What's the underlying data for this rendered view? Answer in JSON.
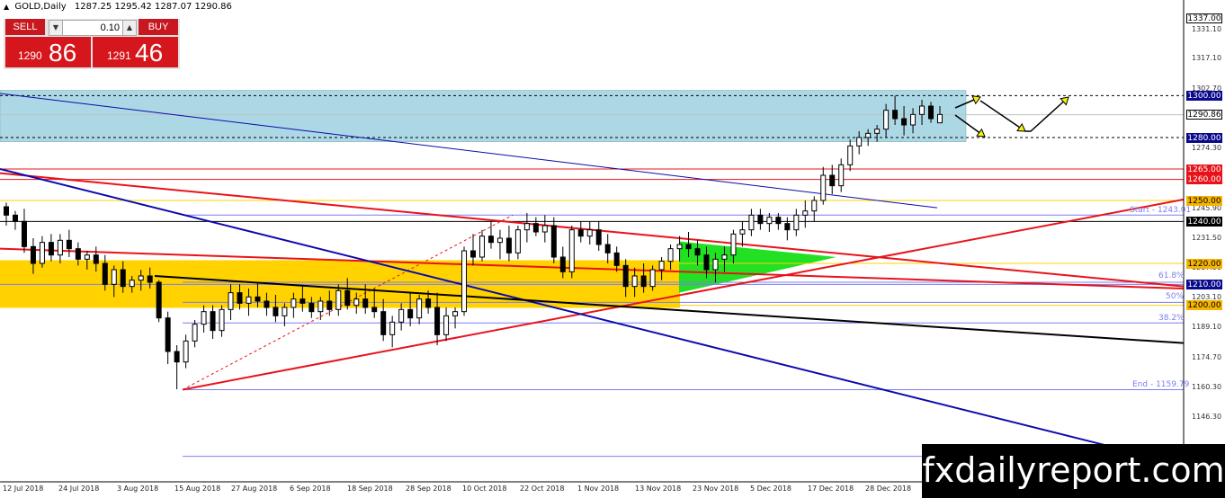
{
  "header": {
    "symbol_label": "GOLD,Daily",
    "ohlc": "1287.25 1295.42 1287.07 1290.86"
  },
  "trade_panel": {
    "sell_label": "SELL",
    "buy_label": "BUY",
    "lot_value": "0.10",
    "sell_small": "1290",
    "sell_big": "86",
    "buy_small": "1291",
    "buy_big": "46"
  },
  "price_axis": {
    "labels": [
      "1331.10",
      "1317.10",
      "1302.70",
      "1274.30",
      "1245.90",
      "1231.50",
      "1217.50",
      "1203.10",
      "1189.10",
      "1174.70",
      "1160.30",
      "1146.30",
      "1131.90"
    ],
    "tags": [
      {
        "text": "1337.00",
        "bg": "#ffffff",
        "fg": "#000000",
        "border": "#000000"
      },
      {
        "text": "1300.00",
        "bg": "#0a0a8c",
        "fg": "#ffffff",
        "border": "#0a0a8c"
      },
      {
        "text": "1290.86",
        "bg": "#ffffff",
        "fg": "#000000",
        "border": "#000000"
      },
      {
        "text": "1280.00",
        "bg": "#0a0a8c",
        "fg": "#ffffff",
        "border": "#0a0a8c"
      },
      {
        "text": "1265.00",
        "bg": "#e8131a",
        "fg": "#ffffff",
        "border": "#e8131a"
      },
      {
        "text": "1260.00",
        "bg": "#e8131a",
        "fg": "#ffffff",
        "border": "#e8131a"
      },
      {
        "text": "1250.00",
        "bg": "#f5b400",
        "fg": "#000000",
        "border": "#f5b400"
      },
      {
        "text": "1240.00",
        "bg": "#000000",
        "fg": "#ffffff",
        "border": "#000000"
      },
      {
        "text": "1220.00",
        "bg": "#f5b400",
        "fg": "#000000",
        "border": "#f5b400"
      },
      {
        "text": "1210.00",
        "bg": "#0a0a8c",
        "fg": "#ffffff",
        "border": "#0a0a8c"
      },
      {
        "text": "1200.00",
        "bg": "#f5b400",
        "fg": "#000000",
        "border": "#f5b400"
      }
    ]
  },
  "time_axis": [
    "12 Jul 2018",
    "24 Jul 2018",
    "3 Aug 2018",
    "15 Aug 2018",
    "27 Aug 2018",
    "6 Sep 2018",
    "18 Sep 2018",
    "28 Sep 2018",
    "10 Oct 2018",
    "22 Oct 2018",
    "1 Nov 2018",
    "13 Nov 2018",
    "23 Nov 2018",
    "5 Dec 2018",
    "17 Dec 2018",
    "28 Dec 2018"
  ],
  "fibonacci": {
    "start": "Start - 1243.01",
    "level_618": "61.8%",
    "level_50": "50%",
    "level_382": "38.2%",
    "end": "End - 1159.79"
  },
  "watermark": "fxdailyreport.com",
  "colors": {
    "resistance_zone": "#acd8e6",
    "support_zone": "#ffd200",
    "triangle": "#22e022",
    "trendline_red": "#e8131a",
    "trendline_blue": "#0a0aaa",
    "fib_line": "#7d7df0",
    "arrow": "#f5f500"
  },
  "candles": [
    [
      1247,
      1249,
      1238,
      1243
    ],
    [
      1243,
      1245,
      1236,
      1240
    ],
    [
      1240,
      1246,
      1225,
      1228
    ],
    [
      1228,
      1232,
      1215,
      1220
    ],
    [
      1220,
      1233,
      1218,
      1230
    ],
    [
      1230,
      1234,
      1221,
      1224
    ],
    [
      1224,
      1234,
      1220,
      1231
    ],
    [
      1231,
      1236,
      1223,
      1227
    ],
    [
      1227,
      1230,
      1219,
      1222
    ],
    [
      1222,
      1226,
      1217,
      1224
    ],
    [
      1224,
      1228,
      1216,
      1220
    ],
    [
      1220,
      1224,
      1207,
      1210
    ],
    [
      1210,
      1219,
      1204,
      1217
    ],
    [
      1217,
      1221,
      1206,
      1209
    ],
    [
      1209,
      1214,
      1206,
      1212
    ],
    [
      1212,
      1217,
      1207,
      1214
    ],
    [
      1214,
      1218,
      1208,
      1211
    ],
    [
      1211,
      1212,
      1192,
      1194
    ],
    [
      1194,
      1197,
      1172,
      1178
    ],
    [
      1178,
      1181,
      1160,
      1173
    ],
    [
      1173,
      1186,
      1170,
      1183
    ],
    [
      1183,
      1193,
      1180,
      1191
    ],
    [
      1191,
      1200,
      1187,
      1197
    ],
    [
      1197,
      1200,
      1184,
      1188
    ],
    [
      1188,
      1200,
      1185,
      1198
    ],
    [
      1198,
      1210,
      1193,
      1206
    ],
    [
      1206,
      1210,
      1198,
      1201
    ],
    [
      1201,
      1208,
      1195,
      1204
    ],
    [
      1204,
      1211,
      1199,
      1202
    ],
    [
      1202,
      1206,
      1195,
      1199
    ],
    [
      1199,
      1205,
      1192,
      1195
    ],
    [
      1195,
      1201,
      1190,
      1199
    ],
    [
      1199,
      1206,
      1194,
      1203
    ],
    [
      1203,
      1209,
      1197,
      1201
    ],
    [
      1201,
      1204,
      1194,
      1197
    ],
    [
      1197,
      1204,
      1193,
      1202
    ],
    [
      1202,
      1207,
      1195,
      1198
    ],
    [
      1198,
      1210,
      1195,
      1207
    ],
    [
      1207,
      1213,
      1198,
      1200
    ],
    [
      1200,
      1206,
      1196,
      1203
    ],
    [
      1203,
      1210,
      1196,
      1199
    ],
    [
      1199,
      1208,
      1194,
      1197
    ],
    [
      1197,
      1203,
      1183,
      1186
    ],
    [
      1186,
      1195,
      1180,
      1192
    ],
    [
      1192,
      1201,
      1188,
      1198
    ],
    [
      1198,
      1206,
      1190,
      1194
    ],
    [
      1194,
      1205,
      1191,
      1203
    ],
    [
      1203,
      1207,
      1196,
      1199
    ],
    [
      1199,
      1206,
      1181,
      1186
    ],
    [
      1186,
      1199,
      1183,
      1195
    ],
    [
      1195,
      1199,
      1189,
      1197
    ],
    [
      1197,
      1228,
      1195,
      1226
    ],
    [
      1226,
      1234,
      1219,
      1223
    ],
    [
      1223,
      1236,
      1221,
      1233
    ],
    [
      1233,
      1240,
      1227,
      1230
    ],
    [
      1230,
      1236,
      1222,
      1232
    ],
    [
      1232,
      1238,
      1221,
      1225
    ],
    [
      1225,
      1238,
      1222,
      1236
    ],
    [
      1236,
      1244,
      1230,
      1239
    ],
    [
      1239,
      1242,
      1233,
      1235
    ],
    [
      1235,
      1243,
      1230,
      1238
    ],
    [
      1238,
      1242,
      1220,
      1223
    ],
    [
      1223,
      1228,
      1213,
      1216
    ],
    [
      1216,
      1238,
      1213,
      1236
    ],
    [
      1236,
      1240,
      1230,
      1233
    ],
    [
      1233,
      1240,
      1229,
      1236
    ],
    [
      1236,
      1240,
      1226,
      1229
    ],
    [
      1229,
      1234,
      1220,
      1225
    ],
    [
      1225,
      1228,
      1216,
      1219
    ],
    [
      1219,
      1222,
      1204,
      1209
    ],
    [
      1209,
      1218,
      1204,
      1214
    ],
    [
      1214,
      1220,
      1206,
      1209
    ],
    [
      1209,
      1219,
      1207,
      1217
    ],
    [
      1217,
      1223,
      1212,
      1221
    ],
    [
      1221,
      1229,
      1217,
      1227
    ],
    [
      1227,
      1233,
      1221,
      1229
    ],
    [
      1229,
      1235,
      1223,
      1227
    ],
    [
      1227,
      1231,
      1219,
      1224
    ],
    [
      1224,
      1228,
      1213,
      1217
    ],
    [
      1217,
      1225,
      1211,
      1222
    ],
    [
      1222,
      1228,
      1216,
      1224
    ],
    [
      1224,
      1236,
      1220,
      1234
    ],
    [
      1234,
      1240,
      1228,
      1236
    ],
    [
      1236,
      1246,
      1233,
      1243
    ],
    [
      1243,
      1246,
      1236,
      1239
    ],
    [
      1239,
      1244,
      1235,
      1242
    ],
    [
      1242,
      1244,
      1236,
      1239
    ],
    [
      1239,
      1242,
      1231,
      1236
    ],
    [
      1236,
      1246,
      1233,
      1243
    ],
    [
      1243,
      1250,
      1237,
      1245
    ],
    [
      1245,
      1252,
      1240,
      1250
    ],
    [
      1250,
      1266,
      1248,
      1262
    ],
    [
      1262,
      1267,
      1253,
      1257
    ],
    [
      1257,
      1270,
      1254,
      1267
    ],
    [
      1267,
      1279,
      1264,
      1276
    ],
    [
      1276,
      1283,
      1272,
      1280
    ],
    [
      1280,
      1284,
      1276,
      1282
    ],
    [
      1282,
      1286,
      1278,
      1284
    ],
    [
      1284,
      1296,
      1280,
      1293
    ],
    [
      1293,
      1300,
      1286,
      1289
    ],
    [
      1289,
      1295,
      1281,
      1286
    ],
    [
      1286,
      1294,
      1282,
      1291
    ],
    [
      1291,
      1298,
      1286,
      1295
    ],
    [
      1295,
      1297,
      1287,
      1289
    ],
    [
      1287,
      1295,
      1287,
      1291
    ]
  ]
}
